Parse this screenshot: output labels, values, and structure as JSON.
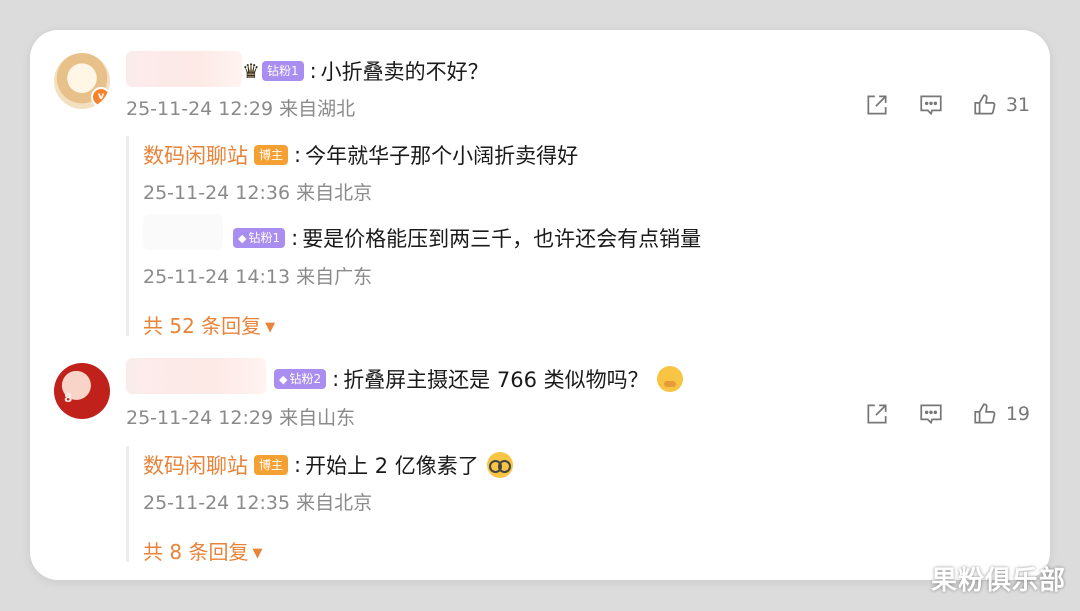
{
  "comments": [
    {
      "badge": "钻粉1",
      "text": "小折叠卖的不好？",
      "meta": "25-11-24 12:29 来自湖北",
      "likes": "31",
      "replies": [
        {
          "name": "数码闲聊站",
          "badge": "博主",
          "text": "今年就华子那个小阔折卖得好",
          "meta": "25-11-24 12:36 来自北京"
        },
        {
          "name": "",
          "badge": "钻粉1",
          "text": "要是价格能压到两三千，也许还会有点销量",
          "meta": "25-11-24 14:13 来自广东"
        }
      ],
      "more": "共 52 条回复"
    },
    {
      "badge": "钻粉2",
      "text": "折叠屏主摄还是 766 类似物吗？",
      "meta": "25-11-24 12:29 来自山东",
      "likes": "19",
      "replies": [
        {
          "name": "数码闲聊站",
          "badge": "博主",
          "text": "开始上 2 亿像素了",
          "meta": "25-11-24 12:35 来自北京"
        }
      ],
      "more": "共 8 条回复"
    }
  ],
  "separator": ":",
  "watermark": "果粉俱乐部",
  "icons": {
    "share": "share-icon",
    "comment": "comment-icon",
    "like": "thumbs-up-icon",
    "crown": "crown-icon",
    "gem": "diamond-icon",
    "caret": "caret-down-icon"
  },
  "colors": {
    "accent": "#e8833a",
    "badge_fan": "#a98df0",
    "badge_blogger": "#f5a032",
    "meta": "#8a8a8a"
  }
}
